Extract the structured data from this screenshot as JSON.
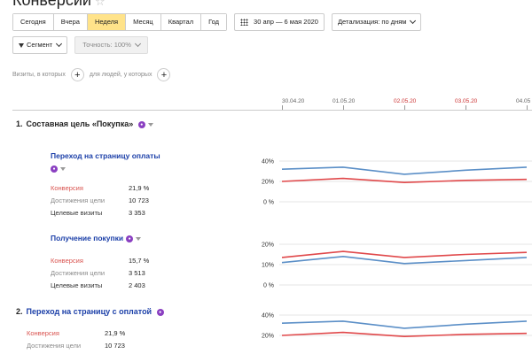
{
  "page": {
    "title": "Конверсии"
  },
  "toolbar": {
    "periods": [
      "Сегодня",
      "Вчера",
      "Неделя",
      "Месяц",
      "Квартал",
      "Год"
    ],
    "active_period": "Неделя",
    "date_range": "30 апр — 6 мая 2020",
    "detail": "Детализация: по дням"
  },
  "filters": {
    "segment": "Сегмент",
    "accuracy": "Точность: 100%"
  },
  "conditions": {
    "visits_label": "Визиты, в которых",
    "people_label": "для людей, у которых",
    "plus": "+"
  },
  "axis": {
    "dates": [
      {
        "label": "30.04.20",
        "weekend": false
      },
      {
        "label": "01.05.20",
        "weekend": false
      },
      {
        "label": "02.05.20",
        "weekend": true
      },
      {
        "label": "03.05.20",
        "weekend": true
      },
      {
        "label": "04.05",
        "weekend": false
      }
    ]
  },
  "goals": {
    "g1": {
      "num": "1.",
      "title": "Составная цель «Покупка»",
      "steps": [
        {
          "title": "Переход на страницу оплаты",
          "conversion_label": "Конверсия",
          "conversion": "21,9 %",
          "reached_label": "Достижения цели",
          "reached": "10 723",
          "visits_label": "Целевые визиты",
          "visits": "3 353"
        },
        {
          "title": "Получение покупки",
          "conversion_label": "Конверсия",
          "conversion": "15,7 %",
          "reached_label": "Достижения цели",
          "reached": "3 513",
          "visits_label": "Целевые визиты",
          "visits": "2 403"
        }
      ]
    },
    "g2": {
      "num": "2.",
      "title": "Переход на страницу с оплатой",
      "conversion_label": "Конверсия",
      "conversion": "21,9 %",
      "reached_label": "Достижения цели",
      "reached": "10 723"
    }
  },
  "colors": {
    "blue": "#5b8fc7",
    "red": "#e0484a",
    "grid": "#e6e6e6"
  },
  "chart_data": [
    {
      "type": "line",
      "ylim": [
        0,
        40
      ],
      "yticks": [
        "40%",
        "20%",
        "0 %"
      ],
      "x": [
        "30.04.20",
        "01.05.20",
        "02.05.20",
        "03.05.20",
        "04.05"
      ],
      "series": [
        {
          "color": "#5b8fc7",
          "values": [
            32,
            34,
            27,
            31,
            34
          ]
        },
        {
          "color": "#e0484a",
          "values": [
            20,
            23,
            19,
            21,
            22
          ]
        }
      ]
    },
    {
      "type": "line",
      "ylim": [
        0,
        20
      ],
      "yticks": [
        "20%",
        "10%",
        "0 %"
      ],
      "x": [
        "30.04.20",
        "01.05.20",
        "02.05.20",
        "03.05.20",
        "04.05"
      ],
      "series": [
        {
          "color": "#e0484a",
          "values": [
            13.5,
            16.5,
            13.5,
            15,
            16
          ]
        },
        {
          "color": "#5b8fc7",
          "values": [
            11,
            14,
            10.5,
            12,
            13.5
          ]
        }
      ]
    },
    {
      "type": "line",
      "ylim": [
        0,
        40
      ],
      "yticks": [
        "40%",
        "20%"
      ],
      "x": [
        "30.04.20",
        "01.05.20",
        "02.05.20",
        "03.05.20",
        "04.05"
      ],
      "series": [
        {
          "color": "#5b8fc7",
          "values": [
            32,
            34,
            27,
            31,
            34
          ]
        },
        {
          "color": "#e0484a",
          "values": [
            20,
            23,
            19,
            21,
            22
          ]
        }
      ]
    }
  ]
}
